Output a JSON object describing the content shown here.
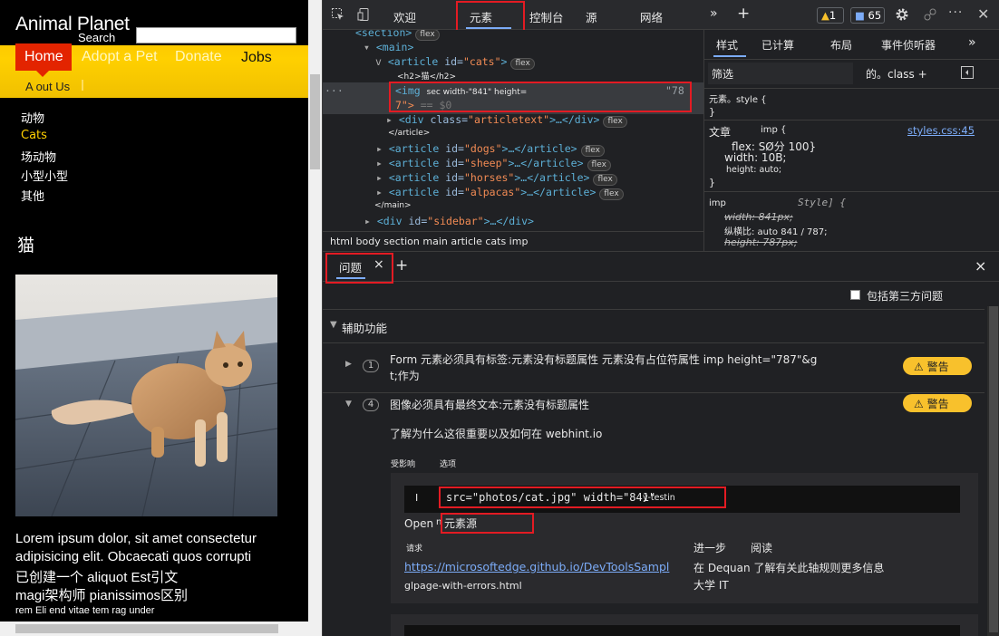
{
  "page": {
    "title": "Animal Planet",
    "search_label": "Search",
    "nav": [
      "Home",
      "Adopt a Pet",
      "Donate",
      "Jobs"
    ],
    "about": "A out Us",
    "sidebar_links": [
      "动物",
      "Cats",
      "场动物",
      "小型小型",
      "其他"
    ],
    "section_heading": "猫",
    "lorem_lines": [
      "Lorem ipsum dolor, sit amet consectetur",
      "adipisicing elit. Obcaecati quos corrupti",
      "已创建一个 aliquot Est引文",
      "magi架构师 pianissimos区别",
      "rem Eli end vitae tem rag under"
    ]
  },
  "devtools": {
    "tabs": [
      "欢迎",
      "元素",
      "控制台",
      "源",
      "网络"
    ],
    "more_tabs": "»",
    "add_tab": "+",
    "warning_count": "1",
    "issue_count": "65",
    "dom": {
      "l1": "<section>",
      "l2": "<main>",
      "l3_tag": "<article",
      "l3_attr": "id=",
      "l3_val": "\"cats\"",
      "l4": "<h2>猫</h2>",
      "sel_tag": "<img",
      "sel_rest": "sec width-\"841\" height=",
      "sel_val": "\"78",
      "sel_line2": "7\">",
      "sel_eq": "== $0",
      "l6_tag": "<div",
      "l6_attr": "class=",
      "l6_val": "\"articletext\"",
      "l6_end": ">…</div>",
      "l7": "</article>",
      "articles": [
        {
          "tag": "<article",
          "attr": "id=",
          "val": "\"dogs\"",
          "end": ">…</article>"
        },
        {
          "tag": "<article",
          "attr": "id=",
          "val": "\"sheep\"",
          "end": ">…</article>"
        },
        {
          "tag": "<article",
          "attr": "id=",
          "val": "\"horses\"",
          "end": ">…</article>"
        },
        {
          "tag": "<article",
          "attr": "id=",
          "val": "\"alpacas\"",
          "end": ">…</article>"
        }
      ],
      "main_close": "</main>",
      "sidebar_tag": "<div",
      "sidebar_attr": "id=",
      "sidebar_val": "\"sidebar\"",
      "sidebar_end": ">…</div>",
      "flex_badge": "flex",
      "ellipsis": "···"
    },
    "breadcrumb": "html body section main article cats imp",
    "styles": {
      "tabs": [
        "样式",
        "已计算",
        "布局",
        "事件侦听器",
        "»"
      ],
      "filter_placeholder": "筛选",
      "filter_right": "的。class +",
      "element_style": "元素。style {",
      "close_brace": "}",
      "rule1_selector": "文章",
      "rule1_sub": "imp {",
      "rule1_link": "styles.css:45",
      "rule1_props": [
        "flex: SØ分 100}",
        "width: 10B;",
        "height: auto;"
      ],
      "rule2_selector": "imp",
      "rule2_source": "Style] {",
      "rule2_props": [
        "width: 841px;",
        "纵横比: auto 841 / 787;",
        "height: 787px;"
      ]
    },
    "drawer": {
      "tab": "问题",
      "close_x": "×",
      "add": "+",
      "third_party": "包括第三方问题",
      "category": "辅助功能",
      "issue1": {
        "count": "1",
        "line1": "Form 元素必须具有标签:元素没有标题属性 元素没有占位符属性 imp height=\"787\"&g",
        "line2": "t;作为",
        "severity": "⚠ 警告"
      },
      "issue2": {
        "count": "4",
        "title": "图像必须具有最终文本:元素没有标题属性",
        "learn": "了解为什么这很重要以及如何在 webhint.io",
        "affected": "受影响",
        "select": "选项",
        "code_left": "I",
        "code": "src=\"photos/cat.jpg\" width=\"841\"",
        "code_right": "y-testin",
        "open": "Open",
        "open_m": "n",
        "open_target": "元素源",
        "request": "请求",
        "next": "进一步",
        "read": "阅读",
        "url": "https://microsoftedge.github.io/DevToolsSampl",
        "url2": "glpage-with-errors.html",
        "dequan": "在 Dequan 了解有关此轴规则更多信息",
        "college": "大学 IT",
        "severity": "⚠ 警告"
      }
    }
  },
  "colors": {
    "accent": "#7cacf8",
    "highlight_box": "#e31b23",
    "warning": "#f8c12c",
    "page_header": "#ffd000",
    "nav_home": "#e32400"
  }
}
